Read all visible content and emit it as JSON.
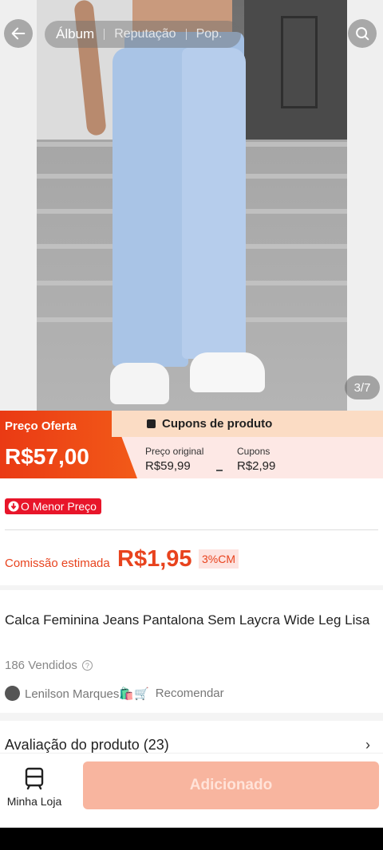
{
  "gallery": {
    "tabs": [
      "Álbum",
      "Reputação",
      "Pop."
    ],
    "counter": "3/7"
  },
  "price": {
    "offer_label": "Preço Oferta",
    "offer_price": "R$57,00",
    "coupon_header": "Cupons de produto",
    "original_label": "Preço original",
    "original_value": "R$59,99",
    "coupons_label": "Cupons",
    "coupons_value": "R$2,99"
  },
  "badge": {
    "label": "O Menor Preço"
  },
  "commission": {
    "label": "Comissão estimada",
    "value": "R$1,95",
    "percent": "3%CM"
  },
  "product": {
    "title": "Calca Feminina Jeans Pantalona Sem Laycra  Wide Leg Lisa",
    "sold": "186 Vendidos",
    "recommender": "Lenilson Marques🛍️🛒",
    "recommend_label": "Recomendar"
  },
  "review": {
    "title": "Avaliação do produto (23)"
  },
  "bottom_bar": {
    "store_label": "Minha Loja",
    "add_button": "Adicionado"
  },
  "colors": {
    "accent": "#ea3a14",
    "commission": "#e8431e",
    "badge": "#e8152a",
    "button_disabled": "#f8b59f"
  },
  "icons": [
    "back-arrow-icon",
    "search-icon",
    "down-arrow-icon",
    "help-icon",
    "store-icon",
    "chevron-right-icon",
    "coupon-icon"
  ]
}
